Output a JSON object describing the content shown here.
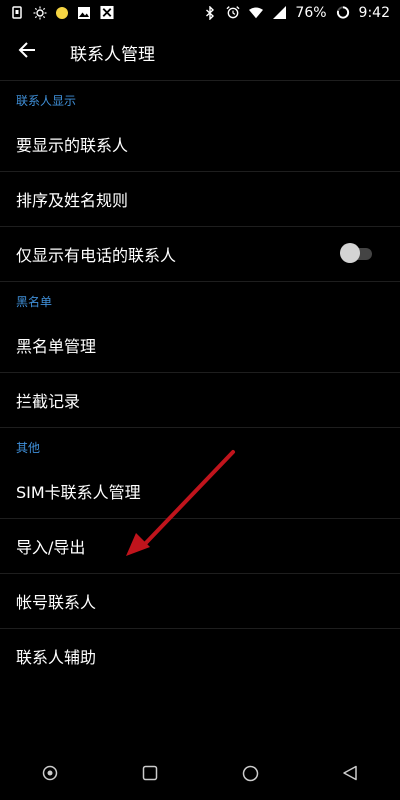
{
  "status_bar": {
    "battery": "76%",
    "time": "9:42",
    "left_icons": [
      "sim-icon",
      "brightness-icon",
      "yellow-dot-icon",
      "image-icon",
      "close-box-icon"
    ],
    "right_icons": [
      "bluetooth-icon",
      "alarm-icon",
      "wifi-icon",
      "signal-icon",
      "battery-ring-icon"
    ]
  },
  "app_bar": {
    "title": "联系人管理",
    "back_icon": "arrow-left-icon"
  },
  "sections": {
    "display": {
      "header": "联系人显示",
      "items": [
        "要显示的联系人",
        "排序及姓名规则",
        "仅显示有电话的联系人"
      ],
      "toggle_on": false
    },
    "blacklist": {
      "header": "黑名单",
      "items": [
        "黑名单管理",
        "拦截记录"
      ]
    },
    "other": {
      "header": "其他",
      "items": [
        "SIM卡联系人管理",
        "导入/导出",
        "帐号联系人",
        "联系人辅助"
      ]
    }
  },
  "nav_bar": {
    "icons": [
      "record-icon",
      "recents-icon",
      "home-icon",
      "back-triangle-icon"
    ]
  },
  "colors": {
    "accent": "#3f8fd8",
    "annotation_arrow": "#c0141c"
  }
}
